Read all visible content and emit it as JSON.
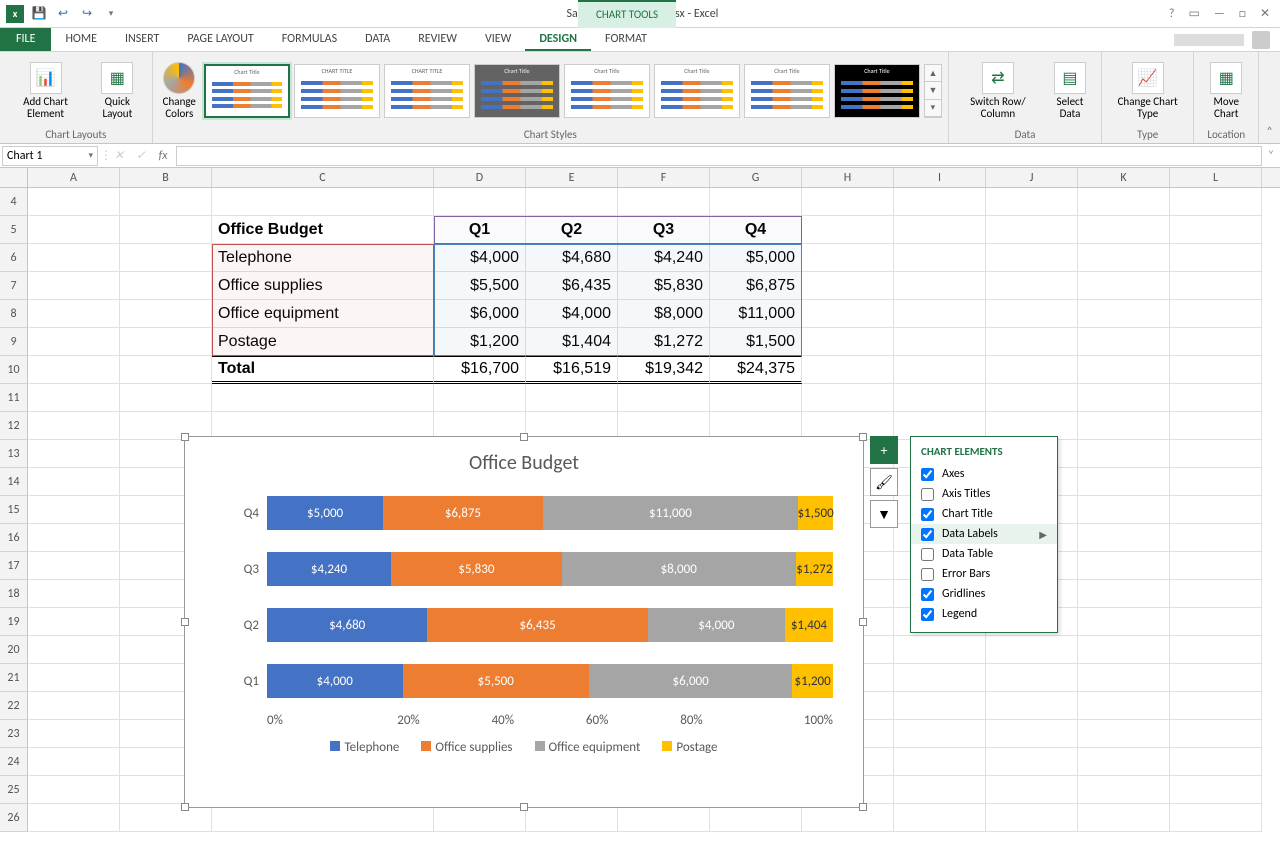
{
  "app": {
    "title": "Sample Chart - DMS.xlsx - Excel",
    "tools_tab": "CHART TOOLS"
  },
  "tabs": {
    "file": "FILE",
    "home": "HOME",
    "insert": "INSERT",
    "page_layout": "PAGE LAYOUT",
    "formulas": "FORMULAS",
    "data": "DATA",
    "review": "REVIEW",
    "view": "VIEW",
    "design": "DESIGN",
    "format": "FORMAT"
  },
  "ribbon": {
    "add_chart_element": "Add Chart\nElement",
    "quick_layout": "Quick\nLayout",
    "change_colors": "Change\nColors",
    "switch_rc": "Switch Row/\nColumn",
    "select_data": "Select\nData",
    "change_type": "Change\nChart Type",
    "move_chart": "Move\nChart",
    "g_layouts": "Chart Layouts",
    "g_styles": "Chart Styles",
    "g_data": "Data",
    "g_type": "Type",
    "g_location": "Location"
  },
  "formula_bar": {
    "name_box": "Chart 1",
    "fx": "fx"
  },
  "columns": [
    "A",
    "B",
    "C",
    "D",
    "E",
    "F",
    "G",
    "H",
    "I",
    "J",
    "K",
    "L"
  ],
  "visible_rows": [
    4,
    5,
    6,
    7,
    8,
    9,
    10,
    11,
    12,
    13,
    14,
    15,
    16,
    17,
    18,
    19,
    20,
    21,
    22,
    23,
    24,
    25,
    26
  ],
  "table": {
    "header_label": "Office Budget",
    "q": [
      "Q1",
      "Q2",
      "Q3",
      "Q4"
    ],
    "rows": [
      {
        "name": "Telephone",
        "v": [
          "$4,000",
          "$4,680",
          "$4,240",
          "$5,000"
        ]
      },
      {
        "name": "Office supplies",
        "v": [
          "$5,500",
          "$6,435",
          "$5,830",
          "$6,875"
        ]
      },
      {
        "name": "Office equipment",
        "v": [
          "$6,000",
          "$4,000",
          "$8,000",
          "$11,000"
        ]
      },
      {
        "name": "Postage",
        "v": [
          "$1,200",
          "$1,404",
          "$1,272",
          "$1,500"
        ]
      }
    ],
    "total_label": "Total",
    "totals": [
      "$16,700",
      "$16,519",
      "$19,342",
      "$24,375"
    ]
  },
  "chart_data": {
    "type": "bar",
    "title": "Office Budget",
    "categories": [
      "Q4",
      "Q3",
      "Q2",
      "Q1"
    ],
    "series": [
      {
        "name": "Telephone",
        "values": [
          5000,
          4240,
          4680,
          4000
        ],
        "labels": [
          "$5,000",
          "$4,240",
          "$4,680",
          "$4,000"
        ],
        "color": "#4472c4"
      },
      {
        "name": "Office supplies",
        "values": [
          6875,
          5830,
          6435,
          5500
        ],
        "labels": [
          "$6,875",
          "$5,830",
          "$6,435",
          "$5,500"
        ],
        "color": "#ed7d31"
      },
      {
        "name": "Office equipment",
        "values": [
          11000,
          8000,
          4000,
          6000
        ],
        "labels": [
          "$11,000",
          "$8,000",
          "$4,000",
          "$6,000"
        ],
        "color": "#a5a5a5"
      },
      {
        "name": "Postage",
        "values": [
          1500,
          1272,
          1404,
          1200
        ],
        "labels": [
          "$1,500",
          "$1,272",
          "$1,404",
          "$1,200"
        ],
        "color": "#ffc000"
      }
    ],
    "xaxis_ticks": [
      "0%",
      "20%",
      "40%",
      "60%",
      "80%",
      "100%"
    ],
    "stacked_100pct": true
  },
  "elements_popup": {
    "header": "CHART ELEMENTS",
    "items": [
      {
        "label": "Axes",
        "checked": true
      },
      {
        "label": "Axis Titles",
        "checked": false
      },
      {
        "label": "Chart Title",
        "checked": true
      },
      {
        "label": "Data Labels",
        "checked": true,
        "hover": true,
        "arrow": true
      },
      {
        "label": "Data Table",
        "checked": false
      },
      {
        "label": "Error Bars",
        "checked": false
      },
      {
        "label": "Gridlines",
        "checked": true
      },
      {
        "label": "Legend",
        "checked": true
      }
    ]
  }
}
